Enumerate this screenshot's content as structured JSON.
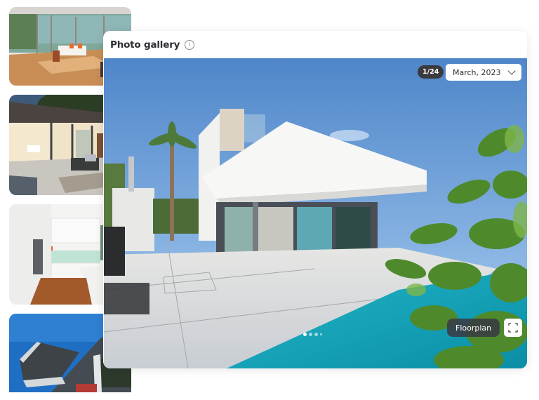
{
  "gallery": {
    "title": "Photo gallery",
    "info_icon": "info-icon",
    "counter": "1/24",
    "date_select": {
      "value": "March, 2023",
      "icon": "chevron-down-icon"
    },
    "floorplan_label": "Floorplan",
    "fullscreen_icon": "expand-icon",
    "pagination": {
      "total_dots": 4,
      "active_index": 0
    }
  },
  "thumbnails": [
    {
      "label": "living-room"
    },
    {
      "label": "patio"
    },
    {
      "label": "kitchen"
    },
    {
      "label": "exterior-facade"
    }
  ],
  "main_photo": {
    "label": "modern-white-house-with-pool"
  }
}
